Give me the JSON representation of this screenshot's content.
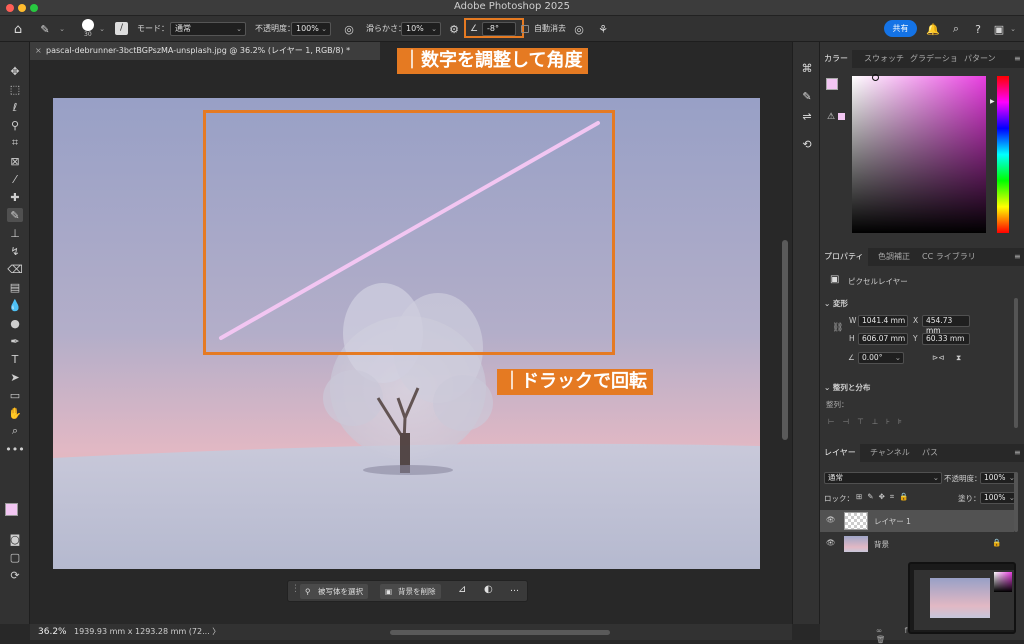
{
  "app": {
    "title": "Adobe Photoshop 2025",
    "share_button": "共有"
  },
  "options_bar": {
    "brush_size": "30",
    "mode_label": "モード：",
    "mode_value": "通常",
    "opacity_label": "不透明度：",
    "opacity_value": "100%",
    "smoothing_label": "滑らかさ：",
    "smoothing_value": "10%",
    "angle_value": "-8°",
    "auto_erase_label": "自動消去"
  },
  "document": {
    "tab_title": "pascal-debrunner-3bctBGPszMA-unsplash.jpg @ 36.2% (レイヤー 1, RGB/8) *"
  },
  "annotations": {
    "top": "｜数字を調整して角度",
    "bottom": "｜ドラックで回転"
  },
  "context_bar": {
    "select_subject": "被写体を選択",
    "remove_bg": "背景を削除",
    "more": "…"
  },
  "status": {
    "zoom": "36.2%",
    "dimensions": "1939.93 mm x 1293.28 mm (72... 〉"
  },
  "color_panel": {
    "tabs": [
      "カラー",
      "スウォッチ",
      "グラデーショ",
      "パターン"
    ],
    "foreground": "#f2c6f2",
    "background": "#000000"
  },
  "properties_panel": {
    "tabs": [
      "プロパティ",
      "色調補正",
      "CC ライブラリ"
    ],
    "layer_kind": "ピクセルレイヤー",
    "transform_label": "変形",
    "w_label": "W",
    "w_value": "1041.4 mm",
    "x_label": "X",
    "x_value": "454.73 mm",
    "h_label": "H",
    "h_value": "606.07 mm",
    "y_label": "Y",
    "y_value": "60.33 mm",
    "angle_value": "0.00°",
    "align_label": "整列と分布",
    "align_sub": "整列："
  },
  "layers_panel": {
    "tabs": [
      "レイヤー",
      "チャンネル",
      "パス"
    ],
    "blend_mode": "通常",
    "opacity_label": "不透明度：",
    "opacity_value": "100%",
    "lock_label": "ロック：",
    "fill_label": "塗り：",
    "fill_value": "100%",
    "layers": [
      {
        "name": "レイヤー 1"
      },
      {
        "name": "背景"
      }
    ]
  },
  "colors": {
    "accent_orange": "#e57a22",
    "share_blue": "#1473e6",
    "brush_line": "#f2c6f2"
  }
}
